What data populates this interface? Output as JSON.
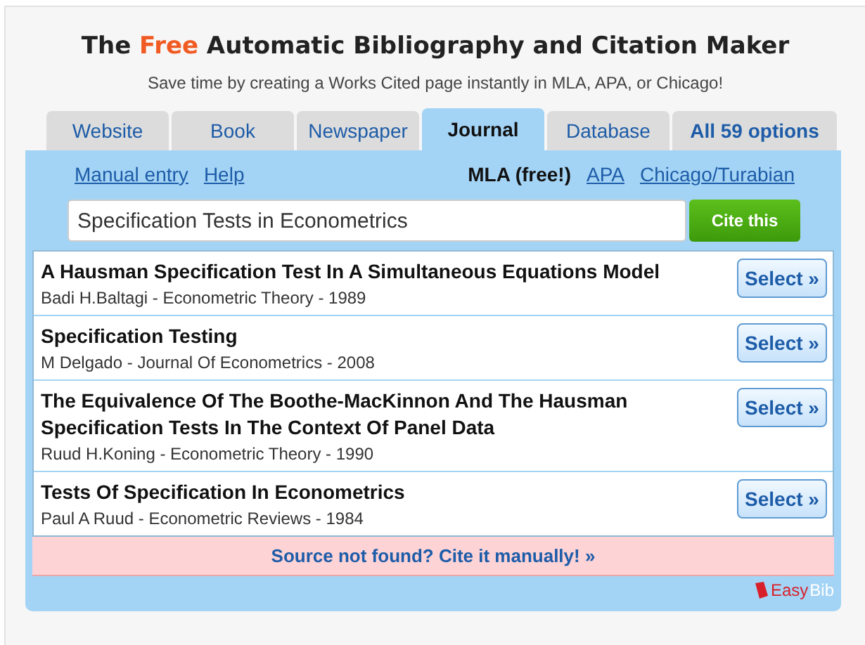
{
  "header": {
    "title_parts": [
      {
        "text": "The ",
        "kind": "plain"
      },
      {
        "text": "Free",
        "kind": "accent"
      },
      {
        "text": " Automatic Bibliography and Citation Maker",
        "kind": "plain"
      }
    ],
    "subtitle": "Save time by creating a Works Cited page instantly in MLA, APA, or Chicago!"
  },
  "tabs": [
    {
      "label": "Website",
      "selected": false,
      "kind": "normal"
    },
    {
      "label": "Book",
      "selected": false,
      "kind": "normal"
    },
    {
      "label": "Newspaper",
      "selected": false,
      "kind": "normal"
    },
    {
      "label": "Journal",
      "selected": true,
      "kind": "normal"
    },
    {
      "label": "Database",
      "selected": false,
      "kind": "normal"
    },
    {
      "label": "All 59 options",
      "selected": false,
      "kind": "bold"
    }
  ],
  "links": [
    "Manual entry",
    "Help"
  ],
  "styles": [
    {
      "label": "MLA (free!)",
      "selected": true
    },
    {
      "label": "APA",
      "selected": false
    },
    {
      "label": "Chicago/Turabian",
      "selected": false
    }
  ],
  "search": {
    "value": "Specification Tests in Econometrics",
    "button": "Cite this"
  },
  "results": [
    {
      "title": "A Hausman Specification Test In A Simultaneous Equations Model",
      "meta": "Badi H.Baltagi - Econometric Theory - 1989",
      "button": "Select »"
    },
    {
      "title": "Specification Testing",
      "meta": "M Delgado - Journal Of Econometrics - 2008",
      "button": "Select »"
    },
    {
      "title": "The Equivalence Of The Boothe-MacKinnon And The Hausman Specification Tests In The Context Of Panel Data",
      "meta": "Ruud H.Koning - Econometric Theory - 1990",
      "button": "Select »"
    },
    {
      "title": "Tests Of Specification In Econometrics",
      "meta": "Paul A Ruud - Econometric Reviews - 1984",
      "button": "Select »"
    }
  ],
  "not_found": "Source not found? Cite it manually! »",
  "logo": {
    "part_1": "Easy",
    "part_2": "Bib"
  }
}
